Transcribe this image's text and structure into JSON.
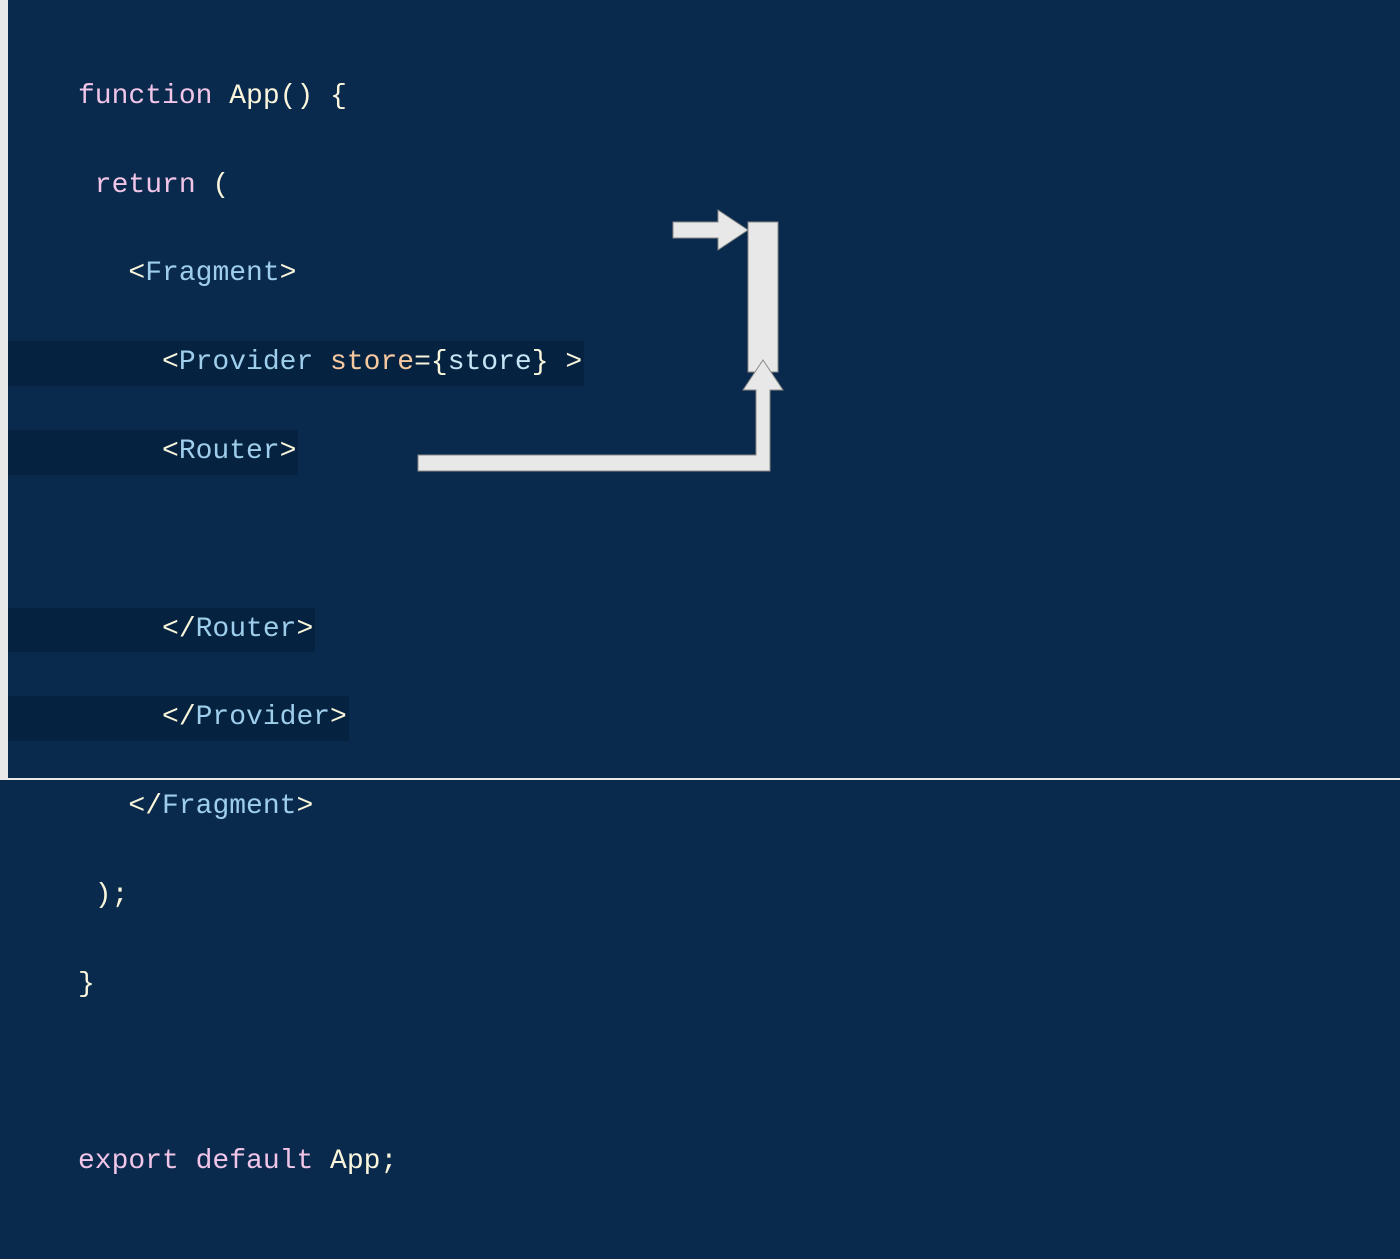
{
  "code": {
    "line1": {
      "kw_function": "function",
      "fn_name": "App",
      "parens": "()",
      "open_brace": " {"
    },
    "line2": {
      "kw_return": " return",
      "open_paren": " ("
    },
    "line3": {
      "indent": "   ",
      "open_angle": "<",
      "tag": "Fragment",
      "close_angle": ">"
    },
    "line4": {
      "indent": "     ",
      "open_angle": "<",
      "tag": "Provider",
      "attr": " store",
      "eq": "=",
      "val_open": "{",
      "val": "store",
      "val_close": "}",
      "close_angle": " >"
    },
    "line5": {
      "indent": "     ",
      "open_angle": "<",
      "tag": "Router",
      "close_angle": ">"
    },
    "line6": {
      "blank": ""
    },
    "line7": {
      "indent": "     ",
      "open_angle": "</",
      "tag": "Router",
      "close_angle": ">"
    },
    "line8": {
      "indent": "     ",
      "open_angle": "</",
      "tag": "Provider",
      "close_angle": ">"
    },
    "line9": {
      "indent": "   ",
      "open_angle": "</",
      "tag": "Fragment",
      "close_angle": ">"
    },
    "line10": {
      "close_paren": " );"
    },
    "line11": {
      "close_brace": "}"
    },
    "line12": {
      "blank": ""
    },
    "line13": {
      "kw_export": "export",
      "kw_default": " default",
      "name": " App",
      "semi": ";"
    }
  }
}
